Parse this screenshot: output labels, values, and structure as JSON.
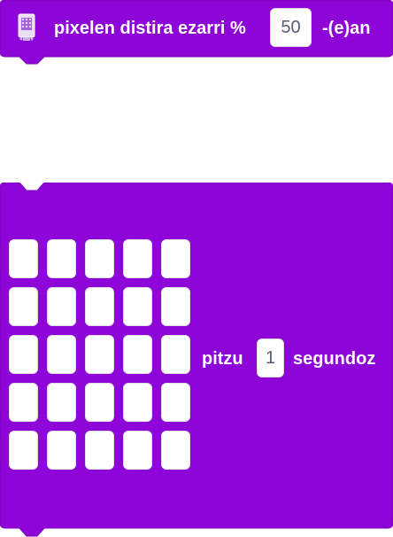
{
  "colors": {
    "block_fill": "#8e05d8",
    "block_stroke": "#7a04ba",
    "input_bg": "#ffffff",
    "input_text": "#575e75",
    "led_off": "#ffffff"
  },
  "brightness_block": {
    "icon": "microbit-display-icon",
    "label_before": "pixelen distira ezarri %",
    "value": "50",
    "label_after": "-(e)an"
  },
  "display_block": {
    "leds": [
      [
        0,
        0,
        0,
        0,
        0
      ],
      [
        0,
        0,
        0,
        0,
        0
      ],
      [
        0,
        0,
        0,
        0,
        0
      ],
      [
        0,
        0,
        0,
        0,
        0
      ],
      [
        0,
        0,
        0,
        0,
        0
      ]
    ],
    "label_before": "pitzu",
    "value": "1",
    "label_after": "segundoz"
  }
}
